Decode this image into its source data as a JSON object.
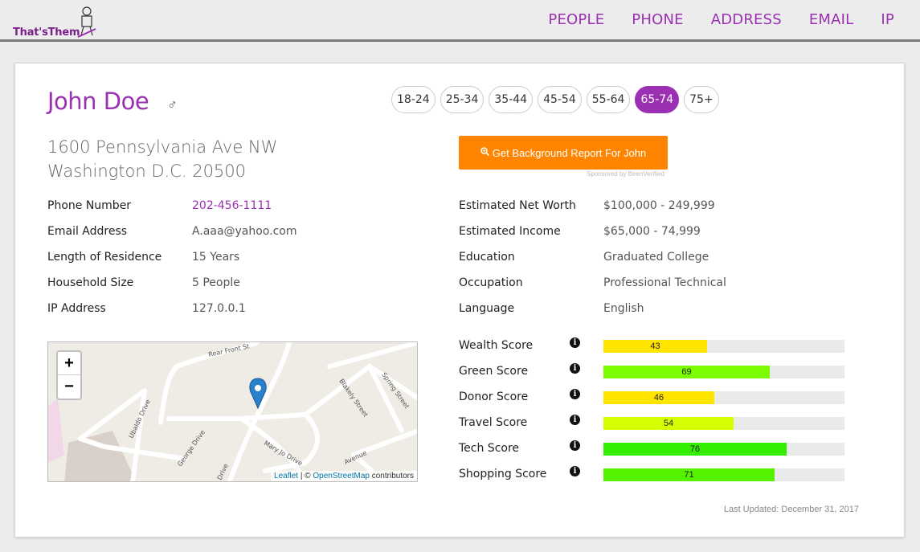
{
  "header": {
    "logo_text": "That'sThem",
    "nav": [
      "PEOPLE",
      "PHONE",
      "ADDRESS",
      "EMAIL",
      "IP"
    ]
  },
  "person": {
    "name": "John Doe",
    "gender_symbol": "♂",
    "address_line1": "1600 Pennsylvania Ave NW",
    "address_line2": "Washington D.C. 20500"
  },
  "age_ranges": [
    {
      "label": "18-24",
      "active": false
    },
    {
      "label": "25-34",
      "active": false
    },
    {
      "label": "35-44",
      "active": false
    },
    {
      "label": "45-54",
      "active": false
    },
    {
      "label": "55-64",
      "active": false
    },
    {
      "label": "65-74",
      "active": true
    },
    {
      "label": "75+",
      "active": false
    }
  ],
  "report_button": {
    "label": "Get Background Report For John",
    "sponsor": "Sponsored by BeenVerified"
  },
  "left_details": [
    {
      "label": "Phone Number",
      "value": "202-456-1111",
      "link": true
    },
    {
      "label": "Email Address",
      "value": "A.aaa@yahoo.com",
      "link": false
    },
    {
      "label": "Length of Residence",
      "value": "15 Years",
      "link": false
    },
    {
      "label": "Household Size",
      "value": "5 People",
      "link": false
    },
    {
      "label": "IP Address",
      "value": "127.0.0.1",
      "link": false
    }
  ],
  "right_details": [
    {
      "label": "Estimated Net Worth",
      "value": "$100,000 - 249,999"
    },
    {
      "label": "Estimated Income",
      "value": "$65,000 - 74,999"
    },
    {
      "label": "Education",
      "value": "Graduated College"
    },
    {
      "label": "Occupation",
      "value": "Professional Technical"
    },
    {
      "label": "Language",
      "value": "English"
    }
  ],
  "map": {
    "zoom_in": "+",
    "zoom_out": "−",
    "attribution_leaflet": "Leaflet",
    "attribution_sep": " | © ",
    "attribution_osm": "OpenStreetMap",
    "attribution_tail": " contributors",
    "streets": [
      "Rear Front St",
      "Blakely Street",
      "Spring Street",
      "Ubaldo Drive",
      "George Drive",
      "Mary Jo Drive",
      "Avenue",
      "Drive"
    ]
  },
  "scores": [
    {
      "label": "Wealth Score",
      "value": 43,
      "color": "#ffe400"
    },
    {
      "label": "Green Score",
      "value": 69,
      "color": "#7cfc00"
    },
    {
      "label": "Donor Score",
      "value": 46,
      "color": "#ffe400"
    },
    {
      "label": "Travel Score",
      "value": 54,
      "color": "#d4ff00"
    },
    {
      "label": "Tech Score",
      "value": 76,
      "color": "#33ee00"
    },
    {
      "label": "Shopping Score",
      "value": 71,
      "color": "#55f200"
    }
  ],
  "info_icon_glyph": "i",
  "last_updated": "Last Updated: December 31, 2017",
  "colors": {
    "brand": "#9b30b3",
    "orange": "#ff8400"
  }
}
